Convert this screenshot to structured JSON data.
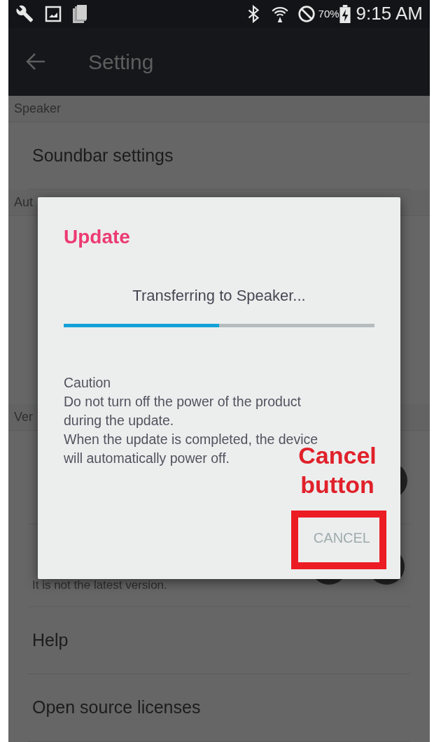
{
  "status_bar": {
    "battery_text": "70%",
    "time": "9:15 AM"
  },
  "app_bar": {
    "title": "Setting"
  },
  "settings": [
    {
      "kind": "header",
      "label": "Speaker"
    },
    {
      "kind": "item",
      "title": "Soundbar settings"
    },
    {
      "kind": "header",
      "label": "Aut"
    },
    {
      "kind": "header",
      "label": "Ver"
    },
    {
      "kind": "item_one_control"
    },
    {
      "kind": "item_two_controls",
      "description_lines": [
        "It is not the latest version."
      ]
    },
    {
      "kind": "item",
      "title": "Help"
    },
    {
      "kind": "item",
      "title": "Open source licenses"
    }
  ],
  "dialog": {
    "title": "Update",
    "message": "Transferring to Speaker...",
    "progress": {
      "level": 0.5
    },
    "caution_lines": [
      "Caution",
      "Do not turn off the power of the product",
      "during the update.",
      "When the update is completed, the device",
      "will automatically power off."
    ],
    "button": {
      "label": "CANCEL",
      "disabled": true
    }
  },
  "annotation": {
    "lines": [
      "Cancel",
      "button"
    ]
  }
}
